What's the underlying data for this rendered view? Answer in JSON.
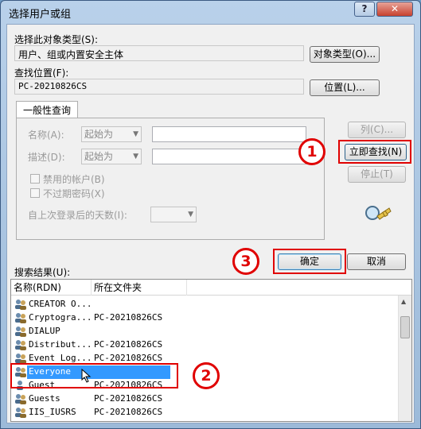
{
  "window": {
    "title": "选择用户或组",
    "help": "?",
    "close": "✕"
  },
  "object_type": {
    "label": "选择此对象类型(S):",
    "value": "用户、组或内置安全主体",
    "button": "对象类型(O)..."
  },
  "location": {
    "label": "查找位置(F):",
    "value": "PC-20210826CS",
    "button": "位置(L)..."
  },
  "query": {
    "tab": "一般性查询",
    "name_label": "名称(A):",
    "desc_label": "描述(D):",
    "combo_value": "起始为",
    "disabled_accounts": "禁用的帐户(B)",
    "non_expiring_pwd": "不过期密码(X)",
    "days_label": "自上次登录后的天数(I):"
  },
  "side_buttons": {
    "columns": "列(C)...",
    "find_now": "立即查找(N)",
    "stop": "停止(T)"
  },
  "dialog_buttons": {
    "ok": "确定",
    "cancel": "取消"
  },
  "results": {
    "label": "搜索结果(U):",
    "columns": [
      "名称(RDN)",
      "所在文件夹"
    ],
    "rows": [
      {
        "name": "CREATOR O...",
        "folder": ""
      },
      {
        "name": "Cryptogra...",
        "folder": "PC-20210826CS"
      },
      {
        "name": "DIALUP",
        "folder": ""
      },
      {
        "name": "Distribut...",
        "folder": "PC-20210826CS"
      },
      {
        "name": "Event Log...",
        "folder": "PC-20210826CS"
      },
      {
        "name": "Everyone",
        "folder": ""
      },
      {
        "name": "Guest",
        "folder": "PC-20210826CS"
      },
      {
        "name": "Guests",
        "folder": "PC-20210826CS"
      },
      {
        "name": "IIS_IUSRS",
        "folder": "PC-20210826CS"
      }
    ]
  },
  "annotations": {
    "step1": "1",
    "step2": "2",
    "step3": "3"
  },
  "colors": {
    "annotation": "#e00000",
    "selection": "#3399ff"
  }
}
